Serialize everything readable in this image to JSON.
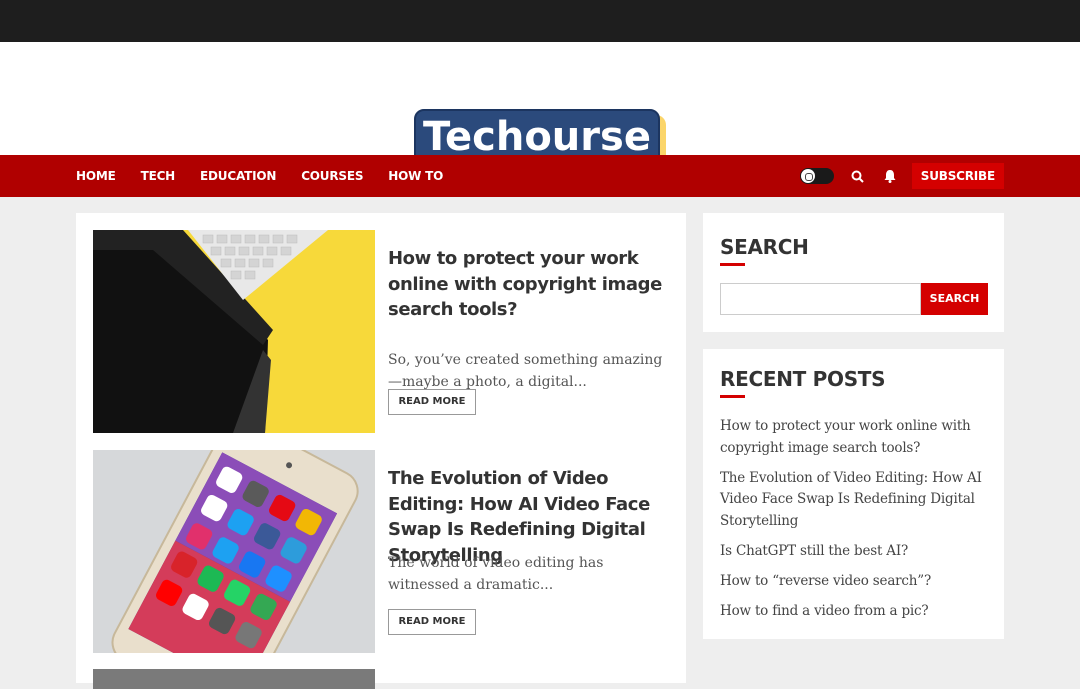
{
  "site": {
    "logo_text": "Techourse"
  },
  "nav": {
    "items": [
      "HOME",
      "TECH",
      "EDUCATION",
      "COURSES",
      "HOW TO"
    ],
    "subscribe_label": "SUBSCRIBE",
    "colors": {
      "bar": "#b00000",
      "accent": "#d40000"
    }
  },
  "posts": [
    {
      "title": "How to protect your work online with copyright image search tools?",
      "excerpt": "So, you’ve created something amazing—maybe a photo, a digital...",
      "read_more": "READ MORE",
      "image": "yellow-desk-tablet-keyboard"
    },
    {
      "title": "The Evolution of Video Editing: How AI Video Face Swap Is Redefining Digital Storytelling",
      "excerpt": "The world of video editing has witnessed a dramatic...",
      "read_more": "READ MORE",
      "image": "smartphone-app-icons"
    }
  ],
  "sidebar": {
    "search": {
      "title": "SEARCH",
      "button_label": "SEARCH",
      "placeholder": ""
    },
    "recent": {
      "title": "RECENT POSTS",
      "items": [
        "How to protect your work online with copyright image search tools?",
        "The Evolution of Video Editing: How AI Video Face Swap Is Redefining Digital Storytelling",
        "Is ChatGPT still the best AI?",
        "How to “reverse video search”?",
        "How to find a video from a pic?"
      ]
    }
  }
}
